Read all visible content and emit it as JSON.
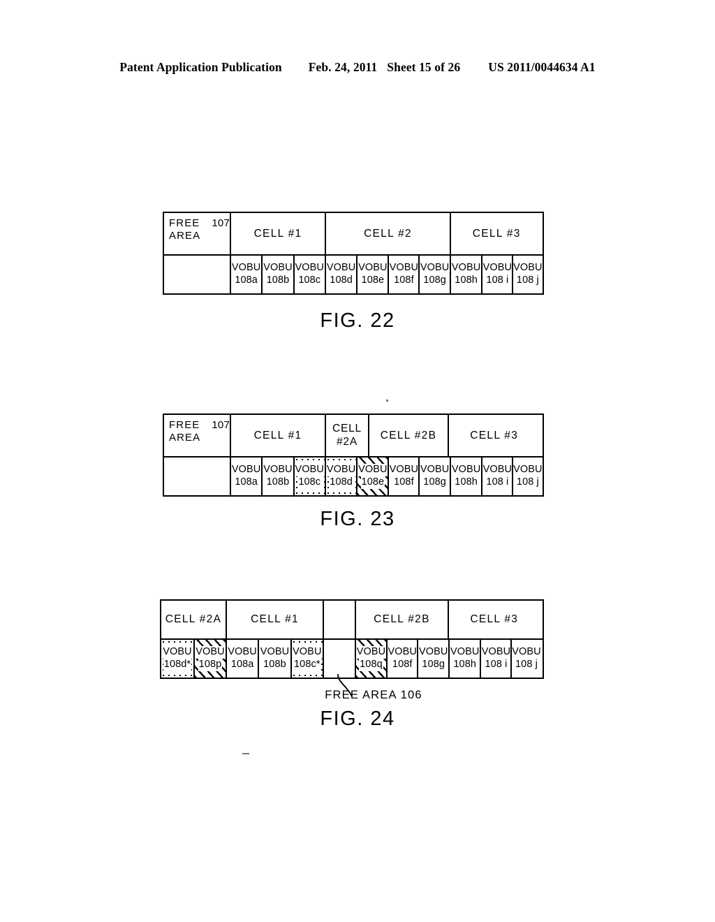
{
  "header": {
    "publication": "Patent Application Publication",
    "date": "Feb. 24, 2011",
    "sheet": "Sheet 15 of 26",
    "patent_number": "US 2011/0044634 A1"
  },
  "figures": [
    {
      "id": "fig22",
      "caption": "FIG. 22",
      "free_area": {
        "line1": "FREE  AREA",
        "line2": "107"
      },
      "cells": [
        {
          "label": "CELL  #1",
          "span": 3
        },
        {
          "label": "CELL  #2",
          "span": 4
        },
        {
          "label": "CELL  #3",
          "span": 3
        }
      ],
      "vobus": [
        {
          "l1": "VOBU",
          "l2": "108a",
          "fill": "none"
        },
        {
          "l1": "VOBU",
          "l2": "108b",
          "fill": "none"
        },
        {
          "l1": "VOBU",
          "l2": "108c",
          "fill": "none"
        },
        {
          "l1": "VOBU",
          "l2": "108d",
          "fill": "none"
        },
        {
          "l1": "VOBU",
          "l2": "108e",
          "fill": "none"
        },
        {
          "l1": "VOBU",
          "l2": "108f",
          "fill": "none"
        },
        {
          "l1": "VOBU",
          "l2": "108g",
          "fill": "none"
        },
        {
          "l1": "VOBU",
          "l2": "108h",
          "fill": "none"
        },
        {
          "l1": "VOBU",
          "l2": "108 i",
          "fill": "none"
        },
        {
          "l1": "VOBU",
          "l2": "108 j",
          "fill": "none"
        }
      ]
    },
    {
      "id": "fig23",
      "caption": "FIG. 23",
      "free_area": {
        "line1": "FREE  AREA",
        "line2": "107"
      },
      "cells": [
        {
          "label": "CELL  #1",
          "span": 3
        },
        {
          "label_line1": "CELL",
          "label_line2": "#2A",
          "span": 2
        },
        {
          "label": "CELL  #2B",
          "span": 2
        },
        {
          "label": "CELL  #3",
          "span": 3
        }
      ],
      "vobus": [
        {
          "l1": "VOBU",
          "l2": "108a",
          "fill": "none"
        },
        {
          "l1": "VOBU",
          "l2": "108b",
          "fill": "none"
        },
        {
          "l1": "VOBU",
          "l2": "108c",
          "fill": "dot"
        },
        {
          "l1": "VOBU",
          "l2": "108d",
          "fill": "dot"
        },
        {
          "l1": "VOBU",
          "l2": "108e",
          "fill": "hatch"
        },
        {
          "l1": "VOBU",
          "l2": "108f",
          "fill": "none"
        },
        {
          "l1": "VOBU",
          "l2": "108g",
          "fill": "none"
        },
        {
          "l1": "VOBU",
          "l2": "108h",
          "fill": "none"
        },
        {
          "l1": "VOBU",
          "l2": "108 i",
          "fill": "none"
        },
        {
          "l1": "VOBU",
          "l2": "108 j",
          "fill": "none"
        }
      ]
    },
    {
      "id": "fig24",
      "caption": "FIG. 24",
      "cells": [
        {
          "label": "CELL  #2A",
          "span": 2
        },
        {
          "label": "CELL  #1",
          "span": 3
        },
        {
          "label": "",
          "span": 1
        },
        {
          "label": "CELL  #2B",
          "span": 3
        },
        {
          "label": "CELL  #3",
          "span": 3
        }
      ],
      "vobus": [
        {
          "l1": "VOBU",
          "l2": "108d*",
          "fill": "dot"
        },
        {
          "l1": "VOBU",
          "l2": "108p",
          "fill": "hatch"
        },
        {
          "l1": "VOBU",
          "l2": "108a",
          "fill": "none"
        },
        {
          "l1": "VOBU",
          "l2": "108b",
          "fill": "none"
        },
        {
          "l1": "VOBU",
          "l2": "108c*",
          "fill": "dot"
        },
        {
          "l1": "",
          "l2": "",
          "fill": "none"
        },
        {
          "l1": "VOBU",
          "l2": "108q",
          "fill": "hatch"
        },
        {
          "l1": "VOBU",
          "l2": "108f",
          "fill": "none"
        },
        {
          "l1": "VOBU",
          "l2": "108g",
          "fill": "none"
        },
        {
          "l1": "VOBU",
          "l2": "108h",
          "fill": "none"
        },
        {
          "l1": "VOBU",
          "l2": "108 i",
          "fill": "none"
        },
        {
          "l1": "VOBU",
          "l2": "108 j",
          "fill": "none"
        }
      ],
      "annotation": {
        "label": "FREE  AREA  106"
      }
    }
  ]
}
